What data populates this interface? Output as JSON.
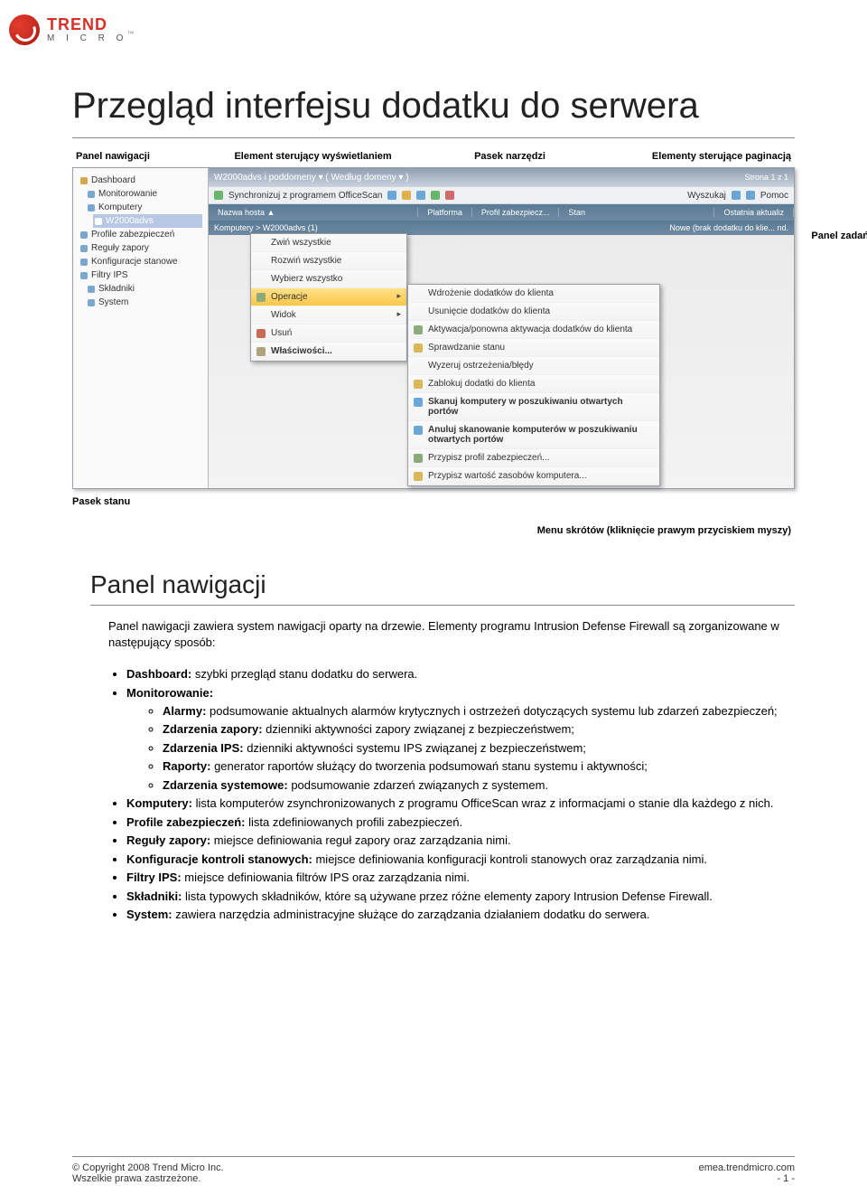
{
  "logo": {
    "brand": "TREND",
    "sub": "M I C R O"
  },
  "title": "Przegląd interfejsu dodatku do serwera",
  "diagram_labels": {
    "top": [
      "Panel nawigacji",
      "Element sterujący wyświetlaniem",
      "Pasek narzędzi",
      "Elementy sterujące paginacją"
    ],
    "right": "Panel zadań",
    "bottom_left": "Pasek stanu",
    "caption": "Menu skrótów (kliknięcie prawym przyciskiem myszy)"
  },
  "app": {
    "nav": [
      "Dashboard",
      "Monitorowanie",
      "Komputery",
      "W2000advs",
      "Profile zabezpieczeń",
      "Reguły zapory",
      "Konfiguracje stanowe",
      "Filtry IPS",
      "Składniki",
      "System"
    ],
    "main_title": "W2000advs i poddomeny ▾ ( Według domeny ▾ )",
    "pagination": "Strona 1 z 1",
    "toolbar": {
      "sync": "Synchronizuj z programem OfficeScan",
      "search": "Wyszukaj",
      "help": "Pomoc"
    },
    "grid_cols": [
      "Nazwa hosta  ▲",
      "Platforma",
      "Profil zabezpiecz...",
      "Stan",
      "Ostatnia aktualiz"
    ],
    "group": "Komputery > W2000advs (1)",
    "group_status": "Nowe (brak dodatku do klie...  nd.",
    "ctx": [
      {
        "label": "Zwiń wszystkie",
        "cls": "none"
      },
      {
        "label": "Rozwiń wszystkie",
        "cls": "none"
      },
      {
        "label": "Wybierz wszystko",
        "cls": "none"
      },
      {
        "label": "Operacje",
        "cls": "hl arrow"
      },
      {
        "label": "Widok",
        "cls": "none arrow"
      },
      {
        "label": "Usuń",
        "cls": "red"
      },
      {
        "label": "Właściwości...",
        "cls": "gear bold"
      }
    ],
    "submenu": [
      {
        "label": "Wdrożenie dodatków do klienta",
        "cls": "none"
      },
      {
        "label": "Usunięcie dodatków do klienta",
        "cls": "none"
      },
      {
        "label": "Aktywacja/ponowna aktywacja dodatków do klienta",
        "cls": ""
      },
      {
        "label": "Sprawdzanie stanu",
        "cls": "y"
      },
      {
        "label": "Wyzeruj ostrzeżenia/błędy",
        "cls": "none"
      },
      {
        "label": "Zablokuj dodatki do klienta",
        "cls": "y"
      },
      {
        "label": "Skanuj komputery w poszukiwaniu otwartych portów",
        "cls": "b"
      },
      {
        "label": "Anuluj skanowanie komputerów w poszukiwaniu otwartych portów",
        "cls": "b"
      },
      {
        "label": "Przypisz profil zabezpieczeń...",
        "cls": ""
      },
      {
        "label": "Przypisz wartość zasobów komputera...",
        "cls": "y"
      }
    ]
  },
  "section_title": "Panel nawigacji",
  "intro": "Panel nawigacji zawiera system nawigacji oparty na drzewie. Elementy programu Intrusion Defense Firewall są zorganizowane w następujący sposób:",
  "bullets": [
    {
      "bold": "Dashboard:",
      "text": " szybki przegląd stanu dodatku do serwera."
    },
    {
      "bold": "Monitorowanie:",
      "text": "",
      "sub": [
        {
          "bold": "Alarmy:",
          "text": " podsumowanie aktualnych alarmów krytycznych i ostrzeżeń dotyczących systemu lub zdarzeń zabezpieczeń;"
        },
        {
          "bold": "Zdarzenia zapory:",
          "text": " dzienniki aktywności zapory związanej z bezpieczeństwem;"
        },
        {
          "bold": "Zdarzenia IPS:",
          "text": " dzienniki aktywności systemu IPS związanej z bezpieczeństwem;"
        },
        {
          "bold": "Raporty:",
          "text": " generator raportów służący do tworzenia podsumowań stanu systemu i aktywności;"
        },
        {
          "bold": "Zdarzenia systemowe:",
          "text": " podsumowanie zdarzeń związanych z systemem."
        }
      ]
    },
    {
      "bold": "Komputery:",
      "text": " lista komputerów zsynchronizowanych z programu OfficeScan wraz z informacjami o stanie dla każdego z nich."
    },
    {
      "bold": "Profile zabezpieczeń:",
      "text": " lista zdefiniowanych profili zabezpieczeń."
    },
    {
      "bold": "Reguły zapory:",
      "text": " miejsce definiowania reguł zapory oraz zarządzania nimi."
    },
    {
      "bold": "Konfiguracje kontroli stanowych:",
      "text": " miejsce definiowania konfiguracji kontroli stanowych oraz zarządzania nimi."
    },
    {
      "bold": "Filtry IPS:",
      "text": " miejsce definiowania filtrów IPS oraz zarządzania nimi."
    },
    {
      "bold": "Składniki:",
      "text": " lista typowych składników, które są używane przez różne elementy zapory Intrusion Defense Firewall."
    },
    {
      "bold": "System:",
      "text": " zawiera narzędzia administracyjne służące do zarządzania działaniem dodatku do serwera."
    }
  ],
  "footer": {
    "left1": "© Copyright 2008 Trend Micro Inc.",
    "left2": "Wszelkie prawa zastrzeżone.",
    "right1": "emea.trendmicro.com",
    "right2": "- 1 -"
  }
}
